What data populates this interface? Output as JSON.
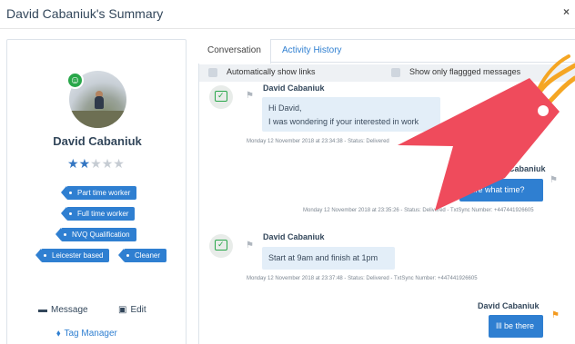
{
  "modal": {
    "title": "David Cabaniuk's Summary",
    "close_label": "×"
  },
  "profile": {
    "name": "David Cabaniuk",
    "rating": 2,
    "rating_max": 5,
    "badge_icon": "smiley-icon",
    "tags": [
      "Part time worker",
      "Full time worker",
      "NVQ Qualification",
      "Leicester based",
      "Cleaner"
    ],
    "actions": {
      "message": "Message",
      "edit": "Edit",
      "tag_manager": "Tag Manager"
    }
  },
  "tabs": [
    {
      "label": "Conversation",
      "active": true
    },
    {
      "label": "Activity History",
      "active": false
    }
  ],
  "filters": {
    "auto_links": "Automatically show links",
    "flagged_only": "Show only flaggged messages"
  },
  "messages": [
    {
      "sender": "David Cabaniuk",
      "direction": "in",
      "line1": "Hi David,",
      "line2": "I was wondering if your interested in work",
      "meta": "Monday 12 November 2018 at 23:34:38 - Status: Delivered"
    },
    {
      "sender": "David Cabaniuk",
      "direction": "out",
      "text": "sure what time?",
      "meta": "Monday 12 November 2018 at 23:35:26 - Status: Delivered - TxtSync Number: +447441926605"
    },
    {
      "sender": "David Cabaniuk",
      "direction": "in",
      "text": "Start at 9am and finish at 1pm",
      "meta": "Monday 12 November 2018 at 23:37:48 - Status: Delivered - TxtSync Number: +447441926605"
    },
    {
      "sender": "David Cabaniuk",
      "direction": "out",
      "text": "Ill be there",
      "flag_color": "#f39a1f"
    }
  ],
  "colors": {
    "accent": "#2f7fd1",
    "overlay_tag": "#ef4b5c",
    "overlay_string": "#f5a623"
  }
}
